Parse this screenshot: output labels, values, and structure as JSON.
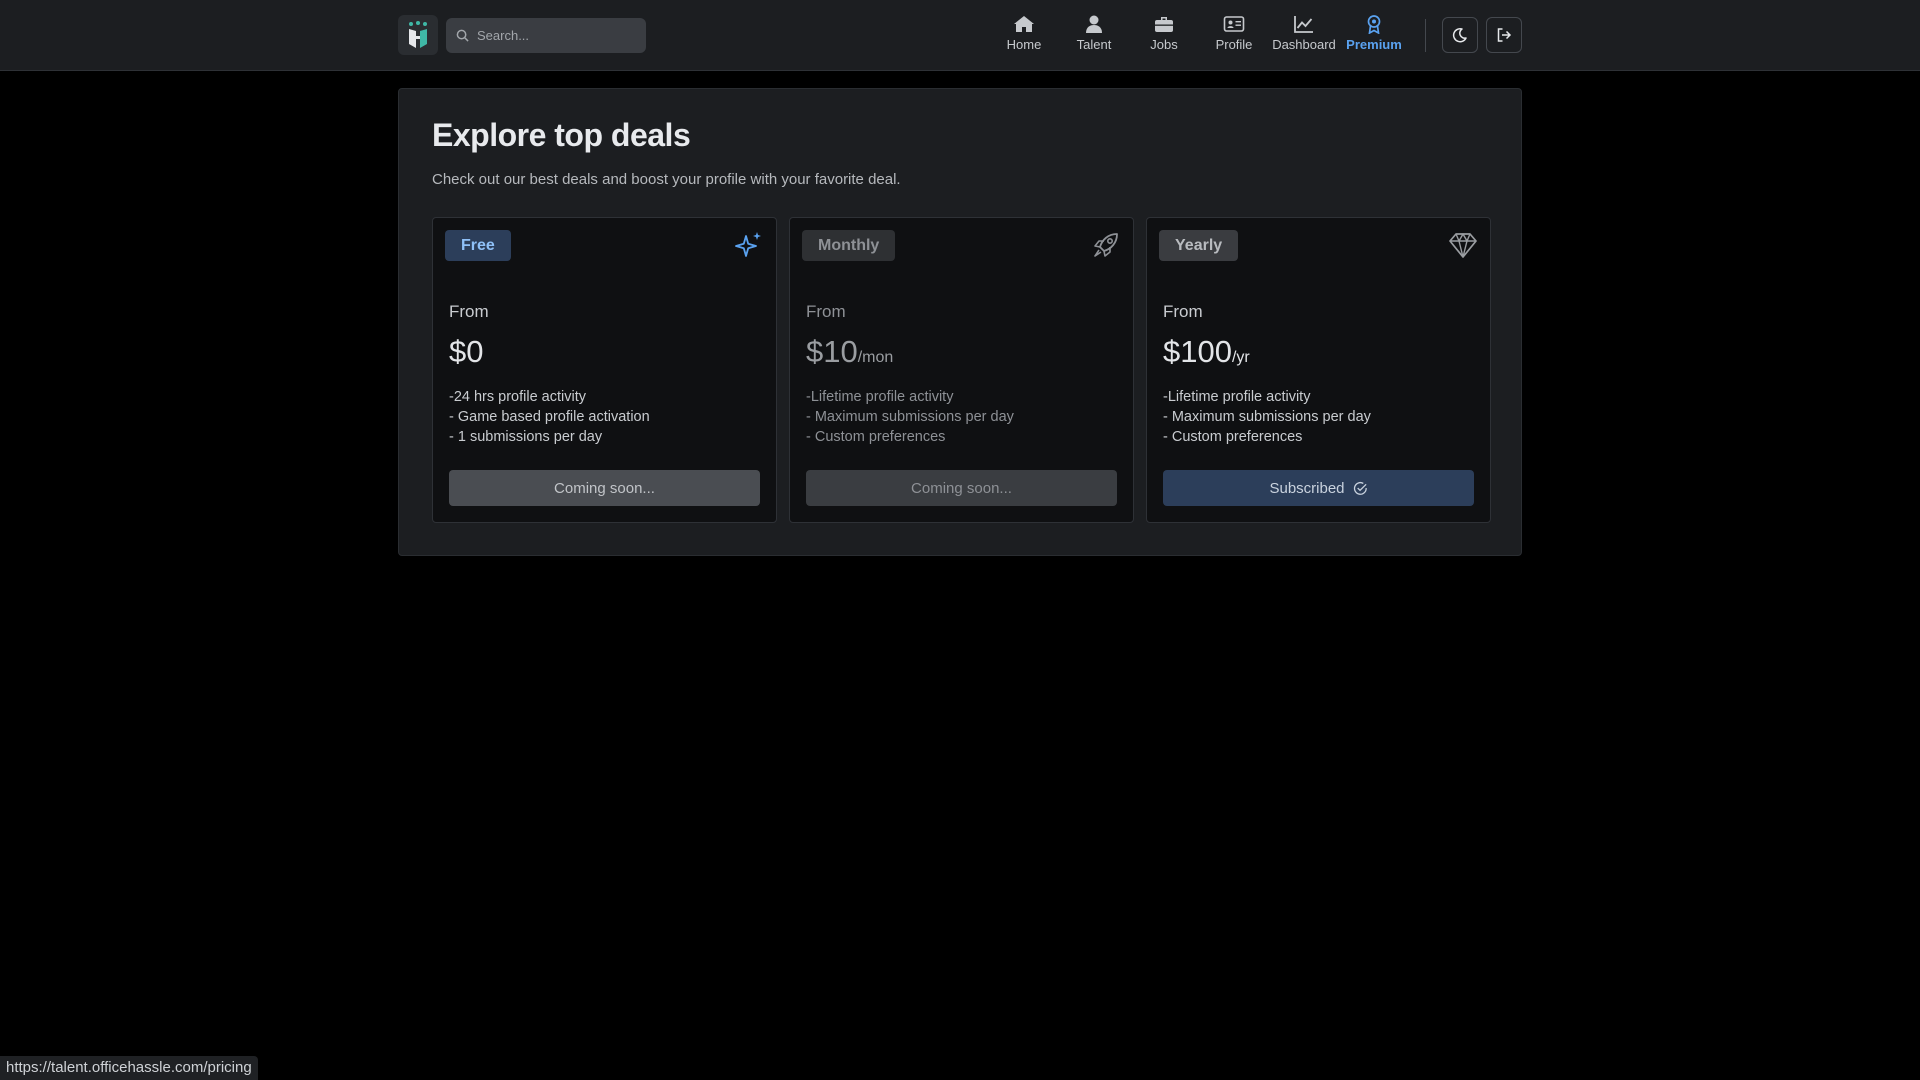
{
  "search": {
    "placeholder": "Search..."
  },
  "nav": {
    "items": [
      {
        "label": "Home",
        "icon": "home-icon"
      },
      {
        "label": "Talent",
        "icon": "user-icon"
      },
      {
        "label": "Jobs",
        "icon": "briefcase-icon"
      },
      {
        "label": "Profile",
        "icon": "id-card-icon"
      },
      {
        "label": "Dashboard",
        "icon": "chart-line-icon"
      },
      {
        "label": "Premium",
        "icon": "award-icon",
        "active": true
      }
    ]
  },
  "page": {
    "title": "Explore top deals",
    "subtitle": "Check out our best deals and boost your profile with your favorite deal."
  },
  "plans": [
    {
      "badge": "Free",
      "icon": "sparkles-icon",
      "from": "From",
      "price": "$0",
      "period": "",
      "features": [
        "-24 hrs profile activity",
        "- Game based profile activation",
        "- 1 submissions per day"
      ],
      "button": "Coming soon..."
    },
    {
      "badge": "Monthly",
      "icon": "rocket-icon",
      "from": "From",
      "price": "$10",
      "period": "/mon",
      "features": [
        "-Lifetime profile activity",
        "- Maximum submissions per day",
        "- Custom preferences"
      ],
      "button": "Coming soon..."
    },
    {
      "badge": "Yearly",
      "icon": "diamond-icon",
      "from": "From",
      "price": "$100",
      "period": "/yr",
      "features": [
        "-Lifetime profile activity",
        "- Maximum submissions per day",
        "- Custom preferences"
      ],
      "button": "Subscribed"
    }
  ],
  "status_url": "https://talent.officehassle.com/pricing",
  "colors": {
    "accent": "#5aa2f0",
    "background": "#000000",
    "surface": "#1c1e21",
    "card": "#0f1012",
    "subscribed_button": "#2c3e5a"
  }
}
